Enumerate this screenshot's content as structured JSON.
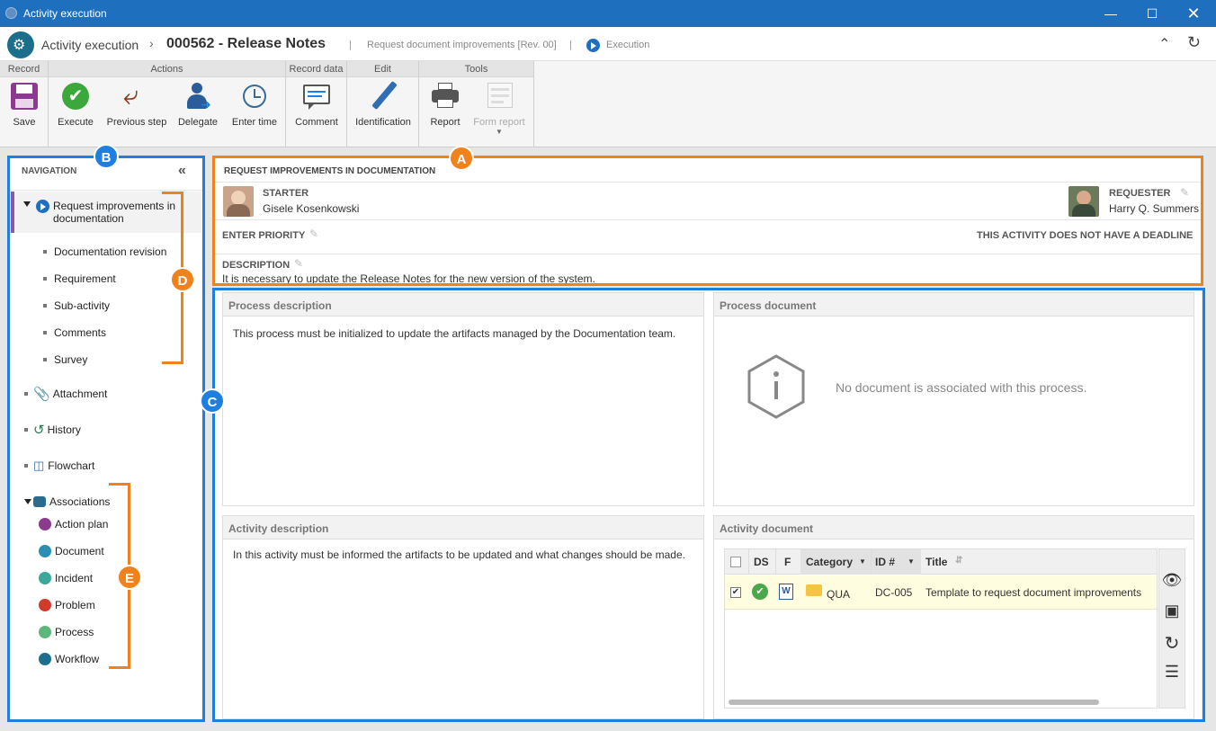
{
  "window": {
    "title": "Activity execution"
  },
  "header": {
    "app": "Activity execution",
    "record": "000562 - Release Notes",
    "process": "Request document improvements [Rev. 00]",
    "status": "Execution"
  },
  "ribbon": {
    "groups": {
      "record": "Record",
      "actions": "Actions",
      "record_data": "Record data",
      "edit": "Edit",
      "tools": "Tools"
    },
    "save": "Save",
    "execute": "Execute",
    "previous_step": "Previous step",
    "delegate": "Delegate",
    "enter_time": "Enter time",
    "comment": "Comment",
    "identification": "Identification",
    "report": "Report",
    "form_report": "Form report"
  },
  "nav": {
    "title": "NAVIGATION",
    "activity": "Request improvements in documentation",
    "sub_items": [
      "Documentation revision",
      "Requirement",
      "Sub-activity",
      "Comments",
      "Survey"
    ],
    "attachment": "Attachment",
    "history": "History",
    "flowchart": "Flowchart",
    "associations": "Associations",
    "assoc_items": [
      "Action plan",
      "Document",
      "Incident",
      "Problem",
      "Process",
      "Workflow"
    ]
  },
  "summary": {
    "title": "REQUEST IMPROVEMENTS IN DOCUMENTATION",
    "starter_label": "STARTER",
    "starter_name": "Gisele Kosenkowski",
    "requester_label": "REQUESTER",
    "requester_name": "Harry Q. Summers",
    "priority_label": "ENTER PRIORITY",
    "deadline": "THIS ACTIVITY DOES NOT HAVE A DEADLINE",
    "description_label": "DESCRIPTION",
    "description": "It is necessary to update the Release Notes for the new version of the system."
  },
  "process_description": {
    "title": "Process description",
    "text": "This process must be initialized to update the artifacts managed by the Documentation team."
  },
  "process_document": {
    "title": "Process document",
    "empty": "No document is associated with this process."
  },
  "activity_description": {
    "title": "Activity description",
    "text": "In this activity must be informed the artifacts to be updated and what changes should be made."
  },
  "activity_document": {
    "title": "Activity document",
    "columns": {
      "ds": "DS",
      "f": "F",
      "category": "Category",
      "id": "ID #",
      "title": "Title"
    },
    "rows": [
      {
        "category": "QUA",
        "id": "DC-005",
        "title": "Template to request document improvements"
      }
    ]
  },
  "markers": {
    "a": "A",
    "b": "B",
    "c": "C",
    "d": "D",
    "e": "E"
  },
  "colors": {
    "titlebar": "#1f6fbf",
    "annotation_orange": "#f0821e",
    "annotation_blue": "#1f7fe0",
    "selected_row": "#fffde0"
  }
}
